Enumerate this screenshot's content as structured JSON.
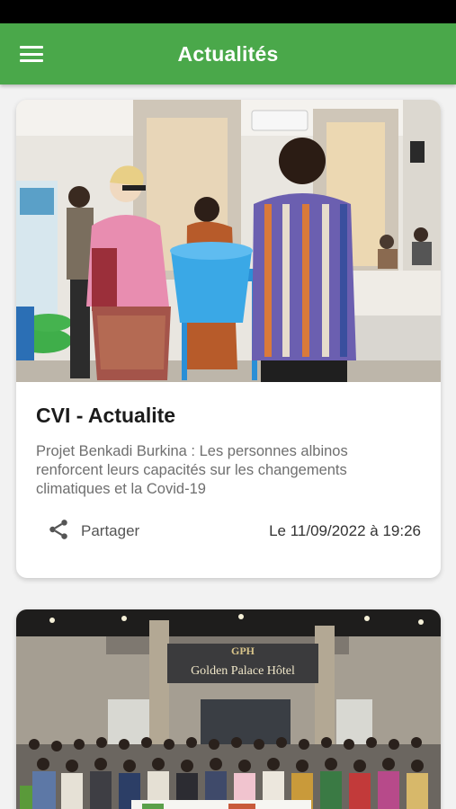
{
  "app_bar": {
    "title": "Actualités",
    "menu_icon": "hamburger-menu-icon",
    "color": "#4aa84a"
  },
  "articles": [
    {
      "title": "CVI - Actualite",
      "description": "Projet Benkadi Burkina : Les personnes albinos renforcent leurs capacités sur les changements climatiques et la Covid-19",
      "share_label": "Partager",
      "share_icon": "share-icon",
      "date": "Le 11/09/2022 à 19:26",
      "image": "photo of a woman and a man holding a blue bucket at a conference"
    },
    {
      "image": "group photo in front of Golden Palace Hôtel",
      "sign_text": "Golden Palace Hôtel",
      "sign_logo": "GPH"
    }
  ]
}
